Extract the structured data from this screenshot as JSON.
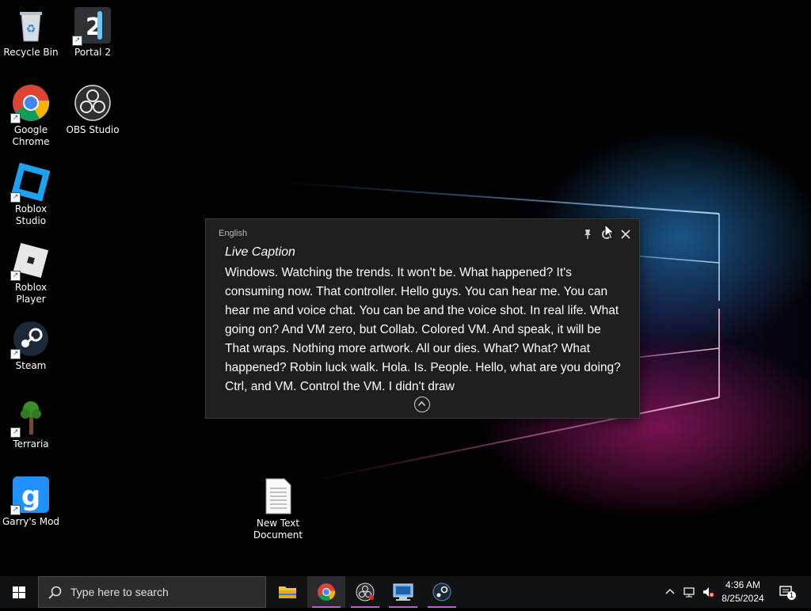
{
  "desktop": {
    "icons": [
      {
        "label": "Recycle Bin",
        "icon": "recycle-bin-icon"
      },
      {
        "label": "Portal 2",
        "icon": "portal-2-icon"
      },
      {
        "label": "Google Chrome",
        "icon": "chrome-icon"
      },
      {
        "label": "OBS Studio",
        "icon": "obs-icon"
      },
      {
        "label": "Roblox Studio",
        "icon": "roblox-studio-icon"
      },
      {
        "label": "Roblox Player",
        "icon": "roblox-player-icon"
      },
      {
        "label": "Steam",
        "icon": "steam-icon"
      },
      {
        "label": "Terraria",
        "icon": "terraria-icon"
      },
      {
        "label": "Garry's Mod",
        "icon": "garrys-mod-icon"
      },
      {
        "label": "New Text Document",
        "icon": "text-document-icon"
      }
    ]
  },
  "live_caption": {
    "language": "English",
    "title": "Live Caption",
    "text": "Windows. Watching the trends. It won't be. What happened? It's consuming now. That controller. Hello guys. You can hear me. You can hear me and voice chat. You can be and the voice shot. In real life. What going on? And VM zero, but Collab. Colored VM. And speak, it will be That wraps. Nothing more artwork. All our dies. What? What? What happened? Robin luck walk. Hola. Is. People. Hello, what are you doing? Ctrl, and VM. Control the VM. I didn't draw",
    "icons": [
      "pin-icon",
      "settings-icon",
      "close-icon",
      "expand-icon"
    ]
  },
  "taskbar": {
    "search_placeholder": "Type here to search",
    "apps": [
      "file-explorer-icon",
      "chrome-icon",
      "obs-icon",
      "remote-desktop-icon",
      "steam-icon"
    ],
    "time": "4:36 AM",
    "date": "8/25/2024",
    "notification_count": "1"
  },
  "colors": {
    "caption_bg": "#1e1e1e",
    "taskbar_bg": "#111214",
    "accent_underline": "#c45ad8"
  }
}
